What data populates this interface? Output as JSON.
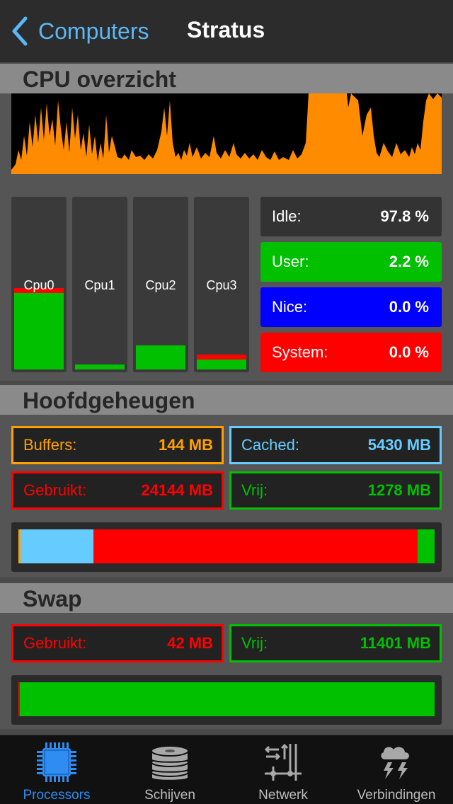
{
  "nav": {
    "back_label": "Computers",
    "title": "Stratus"
  },
  "sections": {
    "cpu": "CPU overzicht",
    "memory": "Hoofdgeheugen",
    "swap": "Swap"
  },
  "cpu_cores": [
    {
      "label": "Cpu0",
      "user_fraction": 0.45,
      "system_fraction": 0.03
    },
    {
      "label": "Cpu1",
      "user_fraction": 0.03,
      "system_fraction": 0.0
    },
    {
      "label": "Cpu2",
      "user_fraction": 0.14,
      "system_fraction": 0.0
    },
    {
      "label": "Cpu3",
      "user_fraction": 0.06,
      "system_fraction": 0.03
    }
  ],
  "cpu_stats": {
    "idle": {
      "label": "Idle:",
      "value": "97.8 %"
    },
    "user": {
      "label": "User:",
      "value": "2.2 %"
    },
    "nice": {
      "label": "Nice:",
      "value": "0.0 %"
    },
    "system": {
      "label": "System:",
      "value": "0.0 %"
    }
  },
  "memory": {
    "buffers": {
      "label": "Buffers:",
      "value": "144 MB"
    },
    "cached": {
      "label": "Cached:",
      "value": "5430 MB"
    },
    "used": {
      "label": "Gebruikt:",
      "value": "24144 MB"
    },
    "free": {
      "label": "Vrij:",
      "value": "1278 MB"
    },
    "bar_fractions": {
      "buffers": 0.005,
      "cached": 0.176,
      "used": 0.779,
      "free": 0.04
    }
  },
  "swap": {
    "used": {
      "label": "Gebruikt:",
      "value": "42 MB"
    },
    "free": {
      "label": "Vrij:",
      "value": "11401 MB"
    },
    "bar_fractions": {
      "used": 0.004,
      "free": 0.996
    }
  },
  "colors": {
    "orange": "#ff8c00",
    "blue_light": "#66ccff",
    "red": "#ff0000",
    "green": "#00c000",
    "nice_blue": "#0000ff",
    "accent": "#2f8cf0"
  },
  "tabs": [
    {
      "label": "Processors",
      "icon": "processor-icon",
      "active": true
    },
    {
      "label": "Schijven",
      "icon": "disk-icon",
      "active": false
    },
    {
      "label": "Netwerk",
      "icon": "network-icon",
      "active": false
    },
    {
      "label": "Verbindingen",
      "icon": "weather-cloud-icon",
      "active": false
    }
  ]
}
